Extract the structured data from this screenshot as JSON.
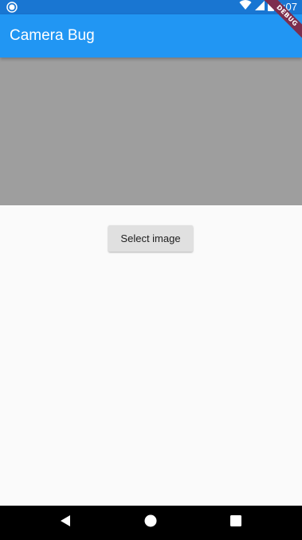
{
  "status_bar": {
    "time": "6:07",
    "icons": [
      "notification-dot-icon",
      "wifi-icon",
      "cell-signal-icon",
      "battery-icon"
    ]
  },
  "app_bar": {
    "title": "Camera Bug",
    "color": "#2196f3"
  },
  "debug_banner": {
    "label": "DEBUG"
  },
  "image_area": {
    "placeholder_color": "#9e9e9e"
  },
  "main": {
    "select_button_label": "Select image"
  },
  "nav_bar": {
    "buttons": [
      "back-icon",
      "home-icon",
      "recents-icon"
    ]
  }
}
